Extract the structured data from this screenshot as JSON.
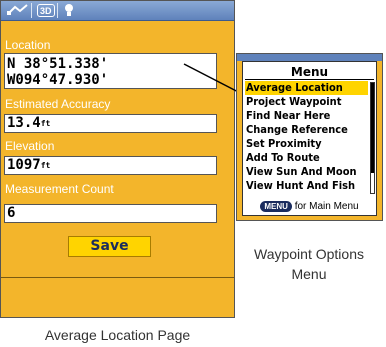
{
  "location_page": {
    "topbar": {
      "tab_icons": [
        "satellite-icon",
        "3d-view-icon",
        "lightbulb-icon"
      ],
      "view_mode_label": "3D"
    },
    "location_label": "Location",
    "latitude": "N  38°51.338'",
    "longitude": "W094°47.930'",
    "accuracy_label": "Estimated Accuracy",
    "accuracy_value": "13.4",
    "accuracy_unit": "ft",
    "elevation_label": "Elevation",
    "elevation_value": "1097",
    "elevation_unit": "ft",
    "count_label": "Measurement Count",
    "count_value": "6",
    "save_label": "Save",
    "caption": "Average Location Page"
  },
  "options_menu": {
    "title": "Menu",
    "items": [
      "Average Location",
      "Project Waypoint",
      "Find Near Here",
      "Change Reference",
      "Set Proximity",
      "Add To Route",
      "View Sun And Moon",
      "View Hunt And Fish"
    ],
    "selected_index": 0,
    "footer_key": "MENU",
    "footer_text": " for Main Menu",
    "caption_line1": "Waypoint Options",
    "caption_line2": "Menu"
  },
  "colors": {
    "screen_bg": "#f3b52b",
    "highlight": "#ffd400",
    "topbar": "#5f82bb"
  }
}
